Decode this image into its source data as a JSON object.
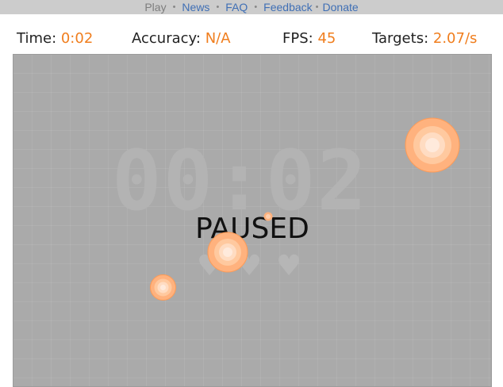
{
  "nav": {
    "items": [
      {
        "label": "Play",
        "active": true
      },
      {
        "label": "News",
        "active": false
      },
      {
        "label": "FAQ",
        "active": false
      },
      {
        "label": "Feedback",
        "active": false
      },
      {
        "label": "Donate",
        "active": false
      }
    ]
  },
  "stats": {
    "time_label": "Time",
    "time_value": "0:02",
    "accuracy_label": "Accuracy",
    "accuracy_value": "N/A",
    "fps_label": "FPS",
    "fps_value": "45",
    "targets_label": "Targets",
    "targets_value": "2.07/s"
  },
  "game": {
    "big_clock": "00:02",
    "status": "PAUSED",
    "lives_icon": "heart-icon",
    "lives_count": 3
  },
  "colors": {
    "accent": "#f07e1e",
    "nav_link": "#3f6fb5",
    "game_bg": "#aaaaaa",
    "target_outer": "#ffb27e",
    "target_mid": "#ffd0ae",
    "target_center": "#ffeadc"
  }
}
